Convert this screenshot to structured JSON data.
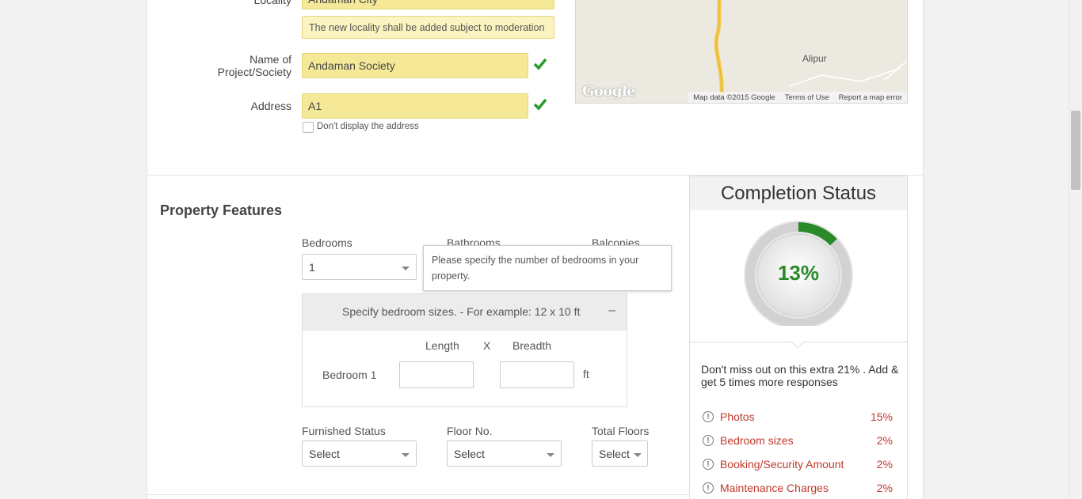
{
  "location": {
    "locality_label": "Locality",
    "locality_value": "Andaman City",
    "moderation_note": "The new locality shall be added subject to moderation",
    "project_label": "Name of Project/Society",
    "project_value": "Andaman Society",
    "address_label": "Address",
    "address_value": "A1",
    "hide_address_label": "Don't display the address"
  },
  "map": {
    "place_label": "Alipur",
    "logo_text": "Google",
    "map_data": "Map data ©2015 Google",
    "terms": "Terms of Use",
    "report": "Report a map error"
  },
  "features": {
    "title": "Property Features",
    "bedrooms_label": "Bedrooms",
    "bedrooms_value": "1",
    "bathrooms_label": "Bathrooms",
    "balconies_label": "Balconies",
    "tooltip": "Please specify the number of bedrooms in your property.",
    "bedroom_sizes_title": "Specify bedroom sizes. - For example: 12 x 10 ft",
    "collapse_symbol": "–",
    "length_label": "Length",
    "x_label": "X",
    "breadth_label": "Breadth",
    "bedroom1_label": "Bedroom 1",
    "unit_label": "ft",
    "furnished_label": "Furnished Status",
    "furnished_value": "Select",
    "floor_label": "Floor No.",
    "floor_value": "Select",
    "total_floors_label": "Total Floors",
    "total_floors_value": "Select"
  },
  "completion": {
    "title": "Completion Status",
    "percent_text": "13%",
    "percent_value": 13,
    "message": "Don't miss out on this extra 21% . Add & get 5 times more responses",
    "items": [
      {
        "label": "Photos",
        "pct": "15%"
      },
      {
        "label": "Bedroom sizes",
        "pct": "2%"
      },
      {
        "label": "Booking/Security Amount",
        "pct": "2%"
      },
      {
        "label": "Maintenance Charges",
        "pct": "2%"
      }
    ],
    "accent_color": "#2a8a2a",
    "missing_color": "#c0392b"
  }
}
